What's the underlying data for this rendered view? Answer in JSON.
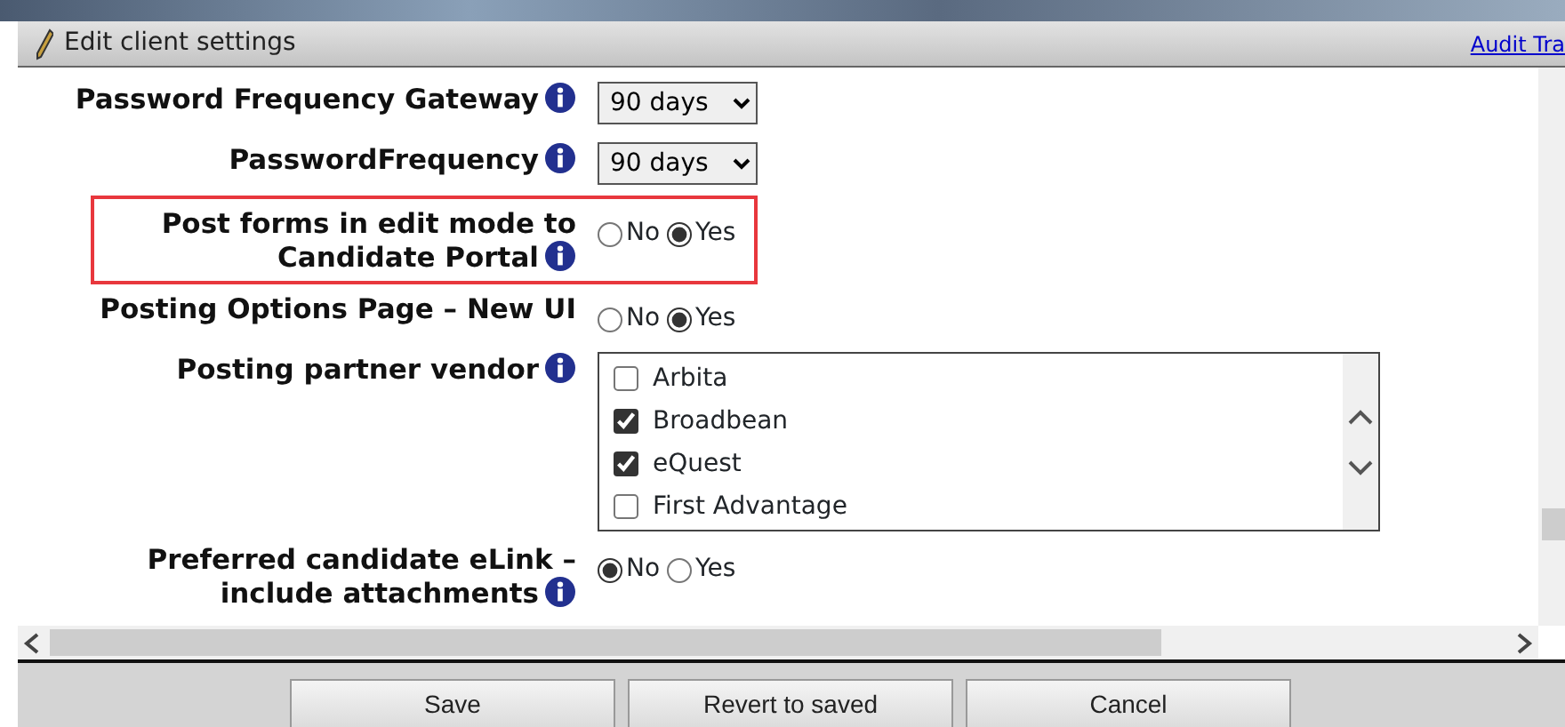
{
  "header": {
    "title": "Edit client settings",
    "link": "Audit Tra"
  },
  "settings": [
    {
      "kind": "select",
      "label": "Password Frequency Gateway",
      "info": true,
      "highlighted": false,
      "value": "90 days"
    },
    {
      "kind": "select",
      "label": "PasswordFrequency",
      "info": true,
      "highlighted": false,
      "value": "90 days"
    },
    {
      "kind": "radio",
      "label": "Post forms in edit mode to Candidate Portal",
      "info": true,
      "highlighted": true,
      "options": [
        {
          "label": "No",
          "selected": false
        },
        {
          "label": "Yes",
          "selected": true
        }
      ]
    },
    {
      "kind": "radio",
      "label": "Posting Options Page – New UI",
      "info": false,
      "highlighted": false,
      "options": [
        {
          "label": "No",
          "selected": false
        },
        {
          "label": "Yes",
          "selected": true
        }
      ]
    },
    {
      "kind": "checklist",
      "label": "Posting partner vendor",
      "info": true,
      "highlighted": false,
      "items": [
        {
          "label": "Arbita",
          "checked": false
        },
        {
          "label": "Broadbean",
          "checked": true
        },
        {
          "label": "eQuest",
          "checked": true
        },
        {
          "label": "First Advantage",
          "checked": false
        }
      ]
    },
    {
      "kind": "radio",
      "label": "Preferred candidate eLink – include attachments",
      "info": true,
      "highlighted": false,
      "options": [
        {
          "label": "No",
          "selected": true
        },
        {
          "label": "Yes",
          "selected": false
        }
      ]
    }
  ],
  "buttons": [
    "Save",
    "Revert to saved",
    "Cancel"
  ]
}
